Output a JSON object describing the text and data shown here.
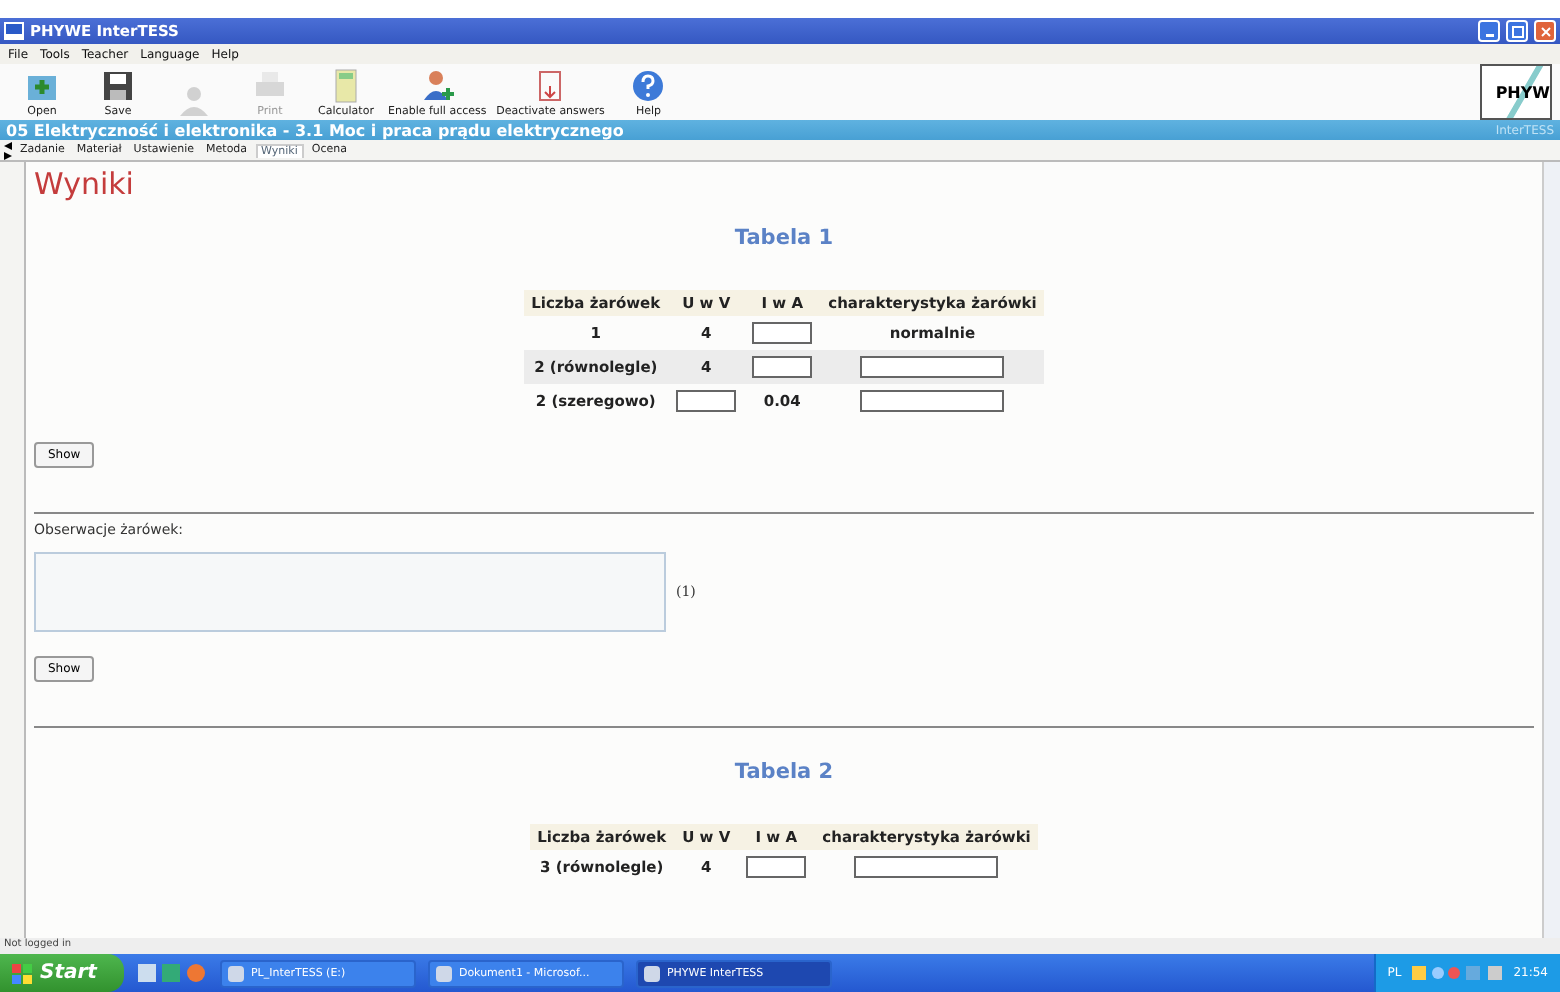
{
  "window": {
    "title": "PHYWE InterTESS"
  },
  "menu": [
    "File",
    "Tools",
    "Teacher",
    "Language",
    "Help"
  ],
  "toolbar": [
    {
      "kind": "open",
      "label": "Open",
      "disabled": false
    },
    {
      "kind": "save",
      "label": "Save",
      "disabled": false
    },
    {
      "kind": "user",
      "disabled": true
    },
    {
      "kind": "print",
      "label": "Print",
      "disabled": true
    },
    {
      "kind": "calculator",
      "label": "Calculator",
      "disabled": false
    },
    {
      "kind": "access",
      "label": "Enable full access",
      "disabled": false
    },
    {
      "kind": "deactivate",
      "label": "Deactivate answers",
      "disabled": false
    },
    {
      "kind": "help",
      "label": "Help",
      "disabled": false
    }
  ],
  "logo": "PHYW",
  "subtitle": {
    "text": "05 Elektryczność i elektronika - 3.1 Moc i praca prądu elektrycznego",
    "right": "InterTESS"
  },
  "tabs": [
    {
      "label": "Zadanie",
      "selected": false
    },
    {
      "label": "Materiał",
      "selected": false
    },
    {
      "label": "Ustawienie",
      "selected": false
    },
    {
      "label": "Metoda",
      "selected": false
    },
    {
      "label": "Wyniki",
      "selected": true
    },
    {
      "label": "Ocena",
      "selected": false
    }
  ],
  "heading": "Wyniki",
  "sections": [
    {
      "kind": "table",
      "title": "Tabela 1",
      "columns": [
        "Liczba żarówek",
        "U w V",
        "I w A",
        "charakterystyka żarówki"
      ],
      "rows": [
        {
          "highlighted": false,
          "cells": [
            {
              "kind": "text",
              "text": "1"
            },
            {
              "kind": "text",
              "text": "4"
            },
            {
              "kind": "input"
            },
            {
              "kind": "text",
              "text": "normalnie"
            }
          ]
        },
        {
          "highlighted": true,
          "cells": [
            {
              "kind": "text",
              "text": "2 (równolegle)"
            },
            {
              "kind": "text",
              "text": "4"
            },
            {
              "kind": "input"
            },
            {
              "kind": "wide-input"
            }
          ]
        },
        {
          "highlighted": false,
          "cells": [
            {
              "kind": "text",
              "text": "2 (szeregowo)"
            },
            {
              "kind": "input"
            },
            {
              "kind": "text",
              "text": "0.04"
            },
            {
              "kind": "wide-input"
            }
          ]
        }
      ],
      "button": "Show"
    },
    {
      "kind": "answer",
      "label": "Obserwacje żarówek:",
      "mark": "(1)",
      "button": "Show"
    },
    {
      "kind": "table",
      "title": "Tabela 2",
      "columns": [
        "Liczba żarówek",
        "U w V",
        "I w A",
        "charakterystyka żarówki"
      ],
      "rows": [
        {
          "highlighted": false,
          "cells": [
            {
              "kind": "text",
              "text": "3 (równolegle)"
            },
            {
              "kind": "text",
              "text": "4"
            },
            {
              "kind": "input"
            },
            {
              "kind": "wide-input"
            }
          ]
        }
      ]
    }
  ],
  "status_bar": "Not logged in",
  "taskbar": {
    "start": "Start",
    "tasks": [
      {
        "label": "PL_InterTESS (E:)",
        "selected": false
      },
      {
        "label": "Dokument1 - Microsof...",
        "selected": false
      },
      {
        "label": "PHYWE InterTESS",
        "selected": true
      }
    ],
    "language": "PL",
    "clock": "21:54"
  }
}
